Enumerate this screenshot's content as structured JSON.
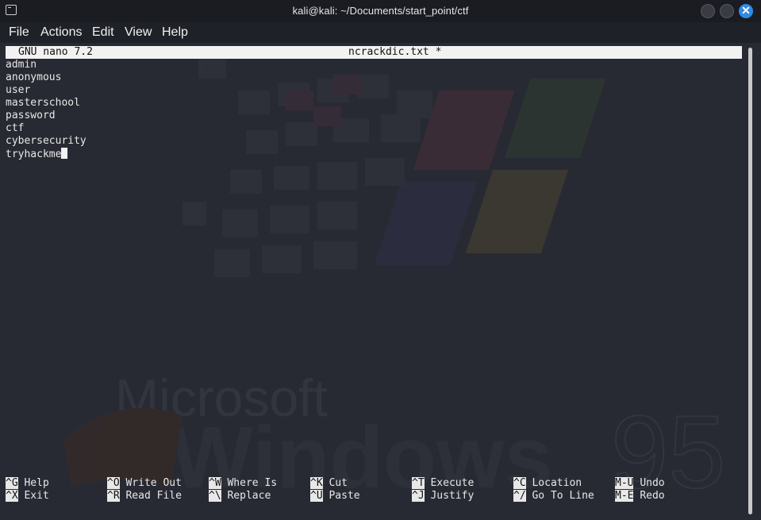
{
  "window": {
    "title": "kali@kali: ~/Documents/start_point/ctf",
    "icon": "terminal-icon",
    "close_glyph": "✕"
  },
  "menu": [
    "File",
    "Actions",
    "Edit",
    "View",
    "Help"
  ],
  "nano": {
    "version": "GNU nano 7.2",
    "filename": "ncrackdic.txt *",
    "lines": [
      "admin",
      "anonymous",
      "user",
      "masterschool",
      "password",
      "ctf",
      "cybersecurity",
      "tryhackme"
    ]
  },
  "shortcuts": [
    {
      "key": "^G",
      "label": "Help"
    },
    {
      "key": "^O",
      "label": "Write Out"
    },
    {
      "key": "^W",
      "label": "Where Is"
    },
    {
      "key": "^K",
      "label": "Cut"
    },
    {
      "key": "^T",
      "label": "Execute"
    },
    {
      "key": "^C",
      "label": "Location"
    },
    {
      "key": "M-U",
      "label": "Undo"
    },
    {
      "key": "^X",
      "label": "Exit"
    },
    {
      "key": "^R",
      "label": "Read File"
    },
    {
      "key": "^\\",
      "label": "Replace"
    },
    {
      "key": "^U",
      "label": "Paste"
    },
    {
      "key": "^J",
      "label": "Justify"
    },
    {
      "key": "^/",
      "label": "Go To Line"
    },
    {
      "key": "M-E",
      "label": "Redo"
    }
  ],
  "wallpaper": {
    "text_top": "Microsoft",
    "text_main": "Windows",
    "text_version": "95"
  },
  "colors": {
    "accent": "#2f8be6",
    "terminal_bg": "#282a33",
    "text": "#e8e8e8"
  }
}
